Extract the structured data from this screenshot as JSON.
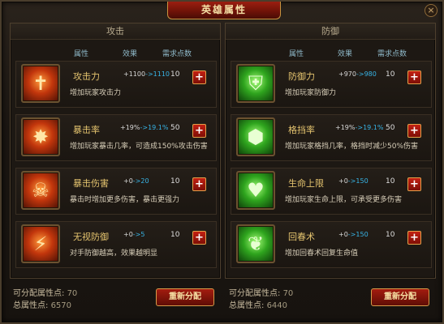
{
  "window": {
    "title": "英雄属性",
    "close_glyph": "×"
  },
  "columns": {
    "attr": "属性",
    "effect": "效果",
    "cost": "需求点数"
  },
  "panels": [
    {
      "header": "攻击",
      "rows": [
        {
          "name": "攻击力",
          "current": "+1100",
          "next": "->1110",
          "cost": "10",
          "desc": "增加玩家攻击力",
          "icon": "sword-icon"
        },
        {
          "name": "暴击率",
          "current": "+19%",
          "next": "->19.1%",
          "cost": "50",
          "desc": "增加玩家暴击几率，可造成150%攻击伤害",
          "icon": "crit-flame-icon"
        },
        {
          "name": "暴击伤害",
          "current": "+0",
          "next": "->20",
          "cost": "10",
          "desc": "暴击时增加更多伤害，暴击更强力",
          "icon": "skull-icon"
        },
        {
          "name": "无视防御",
          "current": "+0",
          "next": "->5",
          "cost": "10",
          "desc": "对手防御越高，效果越明显",
          "icon": "pierce-icon"
        }
      ],
      "footer": {
        "free_label": "可分配属性点:",
        "free_value": "70",
        "total_label": "总属性点:",
        "total_value": "6570",
        "reset": "重新分配"
      }
    },
    {
      "header": "防御",
      "rows": [
        {
          "name": "防御力",
          "current": "+970",
          "next": "->980",
          "cost": "10",
          "desc": "增加玩家防御力",
          "icon": "shield-icon"
        },
        {
          "name": "格挡率",
          "current": "+19%",
          "next": "->19.1%",
          "cost": "50",
          "desc": "增加玩家格挡几率，格挡时减少50%伤害",
          "icon": "block-shield-icon"
        },
        {
          "name": "生命上限",
          "current": "+0",
          "next": "->150",
          "cost": "10",
          "desc": "增加玩家生命上限，可承受更多伤害",
          "icon": "heart-hands-icon"
        },
        {
          "name": "回春术",
          "current": "+0",
          "next": "->150",
          "cost": "10",
          "desc": "增加回春术回复生命值",
          "icon": "regen-icon"
        }
      ],
      "footer": {
        "free_label": "可分配属性点:",
        "free_value": "70",
        "total_label": "总属性点:",
        "total_value": "6440",
        "reset": "重新分配"
      }
    }
  ],
  "colors": {
    "accent_gold": "#e5c46f",
    "next_value_blue": "#37b4e6",
    "button_red": "#a31c0f",
    "column_header": "#8fb9c9"
  }
}
